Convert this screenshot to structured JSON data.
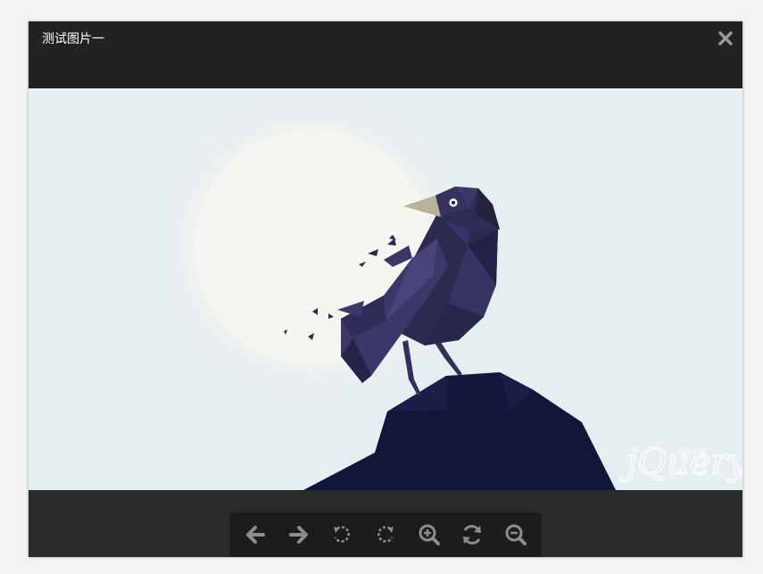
{
  "viewer": {
    "title": "测试图片一",
    "close_icon": "close-icon"
  },
  "image": {
    "subject": "crow on rock in front of moon",
    "watermark": "jQuery",
    "watermark_cn": "插件库"
  },
  "toolbar": {
    "buttons": [
      {
        "icon": "arrow-left-icon",
        "action": "prev"
      },
      {
        "icon": "arrow-right-icon",
        "action": "next"
      },
      {
        "icon": "rotate-left-icon",
        "action": "rotate-left"
      },
      {
        "icon": "rotate-right-icon",
        "action": "rotate-right"
      },
      {
        "icon": "zoom-in-icon",
        "action": "zoom-in"
      },
      {
        "icon": "reset-icon",
        "action": "reset"
      },
      {
        "icon": "zoom-out-icon",
        "action": "zoom-out"
      }
    ]
  },
  "colors": {
    "chrome": "#222222",
    "toolbar": "#1c1c1c",
    "icon": "#8d8d8d",
    "sky": "#e7eef2",
    "moon": "#f4f6ef",
    "crow": "#2c2a4f",
    "rock": "#14173a"
  }
}
